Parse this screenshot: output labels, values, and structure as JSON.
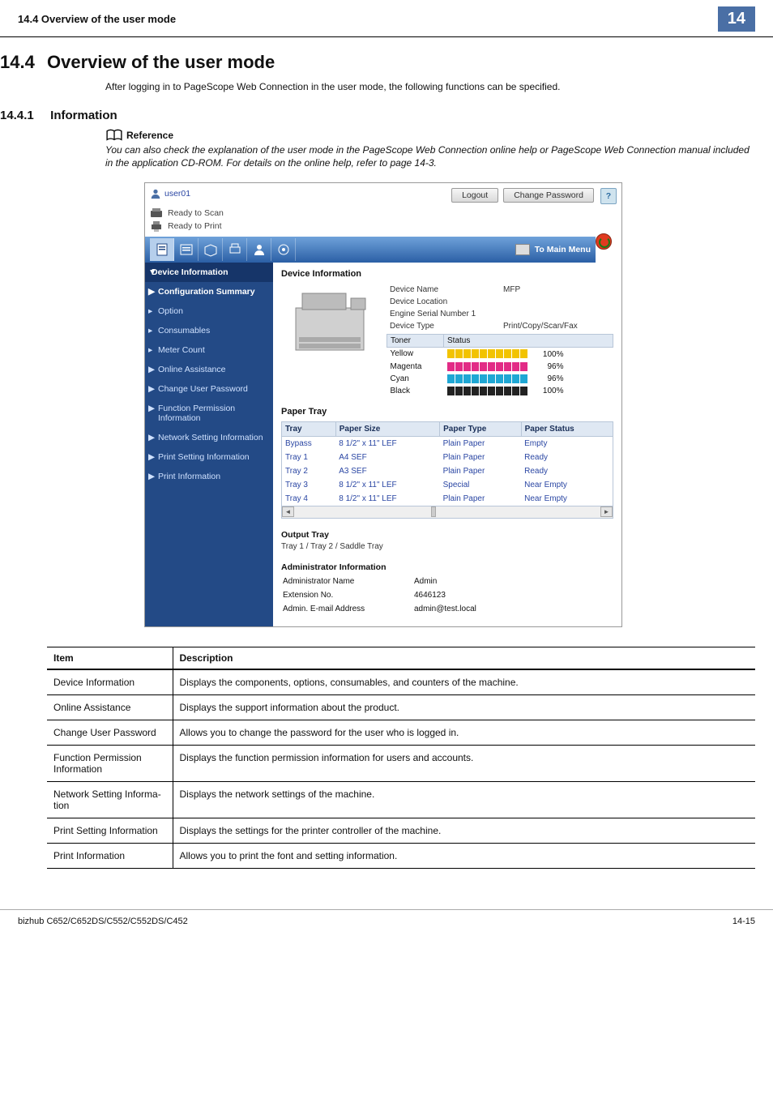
{
  "page_header": {
    "section": "14.4    Overview of the user mode",
    "num": "14"
  },
  "page_footer": {
    "model": "bizhub C652/C652DS/C552/C552DS/C452",
    "page": "14-15"
  },
  "h1_num": "14.4",
  "h1": "Overview of the user mode",
  "intro": "After logging in to PageScope Web Connection in the user mode, the following functions can be specified.",
  "h2_num": "14.4.1",
  "h2": "Information",
  "ref_label": "Reference",
  "ref_text": "You can also check the explanation of the user mode in the PageScope Web Connection online help or PageScope Web Connection manual included in the application CD-ROM. For details on the online help, refer to page 14-3.",
  "shot": {
    "user": "user01",
    "btn_logout": "Logout",
    "btn_chpw": "Change Password",
    "help": "?",
    "ready_scan": "Ready to Scan",
    "ready_print": "Ready to Print",
    "to_main": "To Main Menu",
    "sidebar": [
      {
        "label": "Device Information",
        "type": "h",
        "mark": "▼"
      },
      {
        "label": "Configuration Summary",
        "type": "sel",
        "mark": "▶"
      },
      {
        "label": "Option",
        "mark": "▸"
      },
      {
        "label": "Consumables",
        "mark": "▸"
      },
      {
        "label": "Meter Count",
        "mark": "▸"
      },
      {
        "label": "Online Assistance",
        "mark": "▶"
      },
      {
        "label": "Change User Password",
        "mark": "▶"
      },
      {
        "label": "Function Permission Information",
        "mark": "▶"
      },
      {
        "label": "Network Setting Information",
        "mark": "▶"
      },
      {
        "label": "Print Setting Information",
        "mark": "▶"
      },
      {
        "label": "Print Information",
        "mark": "▶"
      }
    ],
    "main_title": "Device Information",
    "devinfo": {
      "rows": [
        {
          "k": "Device Name",
          "v": "MFP"
        },
        {
          "k": "Device Location",
          "v": ""
        },
        {
          "k": "Engine Serial Number 1",
          "v": ""
        },
        {
          "k": "Device Type",
          "v": "Print/Copy/Scan/Fax"
        }
      ]
    },
    "toner_head": {
      "a": "Toner",
      "b": "Status"
    },
    "toner": [
      {
        "name": "Yellow",
        "seg": 10,
        "color": "#f2c300",
        "pct": "100%"
      },
      {
        "name": "Magenta",
        "seg": 10,
        "color": "#e22b86",
        "pct": "96%"
      },
      {
        "name": "Cyan",
        "seg": 10,
        "color": "#1fa7d4",
        "pct": "96%"
      },
      {
        "name": "Black",
        "seg": 10,
        "color": "#222",
        "pct": "100%"
      }
    ],
    "ptray_title": "Paper Tray",
    "ptray_head": [
      "Tray",
      "Paper Size",
      "Paper Type",
      "Paper Status"
    ],
    "ptray_rows": [
      [
        "Bypass",
        "8 1/2\" x 11\" LEF",
        "Plain Paper",
        "Empty"
      ],
      [
        "Tray 1",
        "A4 SEF",
        "Plain Paper",
        "Ready"
      ],
      [
        "Tray 2",
        "A3 SEF",
        "Plain Paper",
        "Ready"
      ],
      [
        "Tray 3",
        "8 1/2\" x 11\" LEF",
        "Special",
        "Near Empty"
      ],
      [
        "Tray 4",
        "8 1/2\" x 11\" LEF",
        "Plain Paper",
        "Near Empty"
      ]
    ],
    "out_title": "Output Tray",
    "out_list": "Tray 1 / Tray 2 / Saddle Tray",
    "adm_title": "Administrator Information",
    "adm_rows": [
      {
        "k": "Administrator Name",
        "v": "Admin"
      },
      {
        "k": "Extension No.",
        "v": "4646123"
      },
      {
        "k": "Admin. E-mail Address",
        "v": "admin@test.local"
      }
    ]
  },
  "desc_head": {
    "item": "Item",
    "desc": "Description"
  },
  "desc": [
    {
      "item": "Device Information",
      "desc": "Displays the components, options, consumables, and counters of the machine."
    },
    {
      "item": "Online Assistance",
      "desc": "Displays the support information about the product."
    },
    {
      "item": "Change User Password",
      "desc": "Allows you to change the password for the user who is logged in."
    },
    {
      "item": "Function Permission Information",
      "desc": "Displays the function permission information for users and accounts."
    },
    {
      "item": "Network Setting Information",
      "desc": "Displays the network settings of the machine."
    },
    {
      "item": "Print Setting Information",
      "desc": "Displays the settings for the printer controller of the machine."
    },
    {
      "item": "Print Information",
      "desc": "Allows you to print the font and setting information."
    }
  ]
}
